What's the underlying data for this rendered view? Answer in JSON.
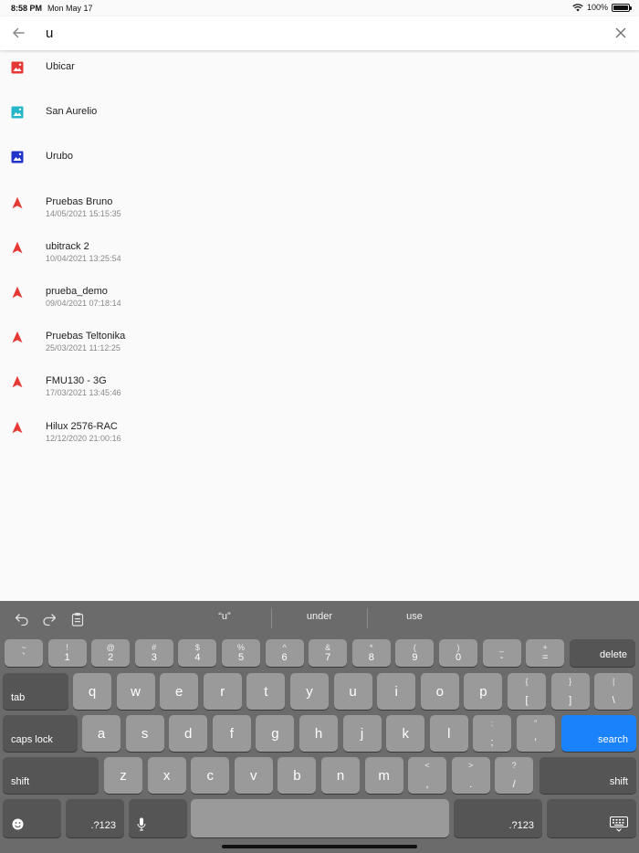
{
  "status": {
    "time": "8:58 PM",
    "date": "Mon May 17",
    "battery": "100%"
  },
  "search": {
    "query": "u",
    "placeholder": ""
  },
  "results": [
    {
      "type": "map",
      "color": "#e53935",
      "title": "Ubicar",
      "subtitle": ""
    },
    {
      "type": "map",
      "color": "#26b6c9",
      "title": "San Aurelio",
      "subtitle": ""
    },
    {
      "type": "map",
      "color": "#2233c9",
      "title": "Urubo",
      "subtitle": ""
    },
    {
      "type": "vehicle",
      "color": "#e53935",
      "title": "Pruebas Bruno",
      "subtitle": "14/05/2021 15:15:35"
    },
    {
      "type": "vehicle",
      "color": "#e53935",
      "title": "ubitrack 2",
      "subtitle": "10/04/2021 13:25:54"
    },
    {
      "type": "vehicle",
      "color": "#e53935",
      "title": "prueba_demo",
      "subtitle": "09/04/2021 07:18:14"
    },
    {
      "type": "vehicle",
      "color": "#e53935",
      "title": "Pruebas Teltonika",
      "subtitle": "25/03/2021 11:12:25"
    },
    {
      "type": "vehicle",
      "color": "#e53935",
      "title": "FMU130 - 3G",
      "subtitle": "17/03/2021 13:45:46"
    },
    {
      "type": "vehicle",
      "color": "#e53935",
      "title": "Hilux 2576-RAC",
      "subtitle": "12/12/2020 21:00:16"
    }
  ],
  "keyboard": {
    "predictions": [
      "“u”",
      "under",
      "use"
    ],
    "number_row": [
      {
        "top": "~",
        "bot": "`"
      },
      {
        "top": "!",
        "bot": "1"
      },
      {
        "top": "@",
        "bot": "2"
      },
      {
        "top": "#",
        "bot": "3"
      },
      {
        "top": "$",
        "bot": "4"
      },
      {
        "top": "%",
        "bot": "5"
      },
      {
        "top": "^",
        "bot": "6"
      },
      {
        "top": "&",
        "bot": "7"
      },
      {
        "top": "*",
        "bot": "8"
      },
      {
        "top": "(",
        "bot": "9"
      },
      {
        "top": ")",
        "bot": "0"
      },
      {
        "top": "_",
        "bot": "-"
      },
      {
        "top": "+",
        "bot": "="
      }
    ],
    "delete": "delete",
    "tab": "tab",
    "row_q": [
      "q",
      "w",
      "e",
      "r",
      "t",
      "y",
      "u",
      "i",
      "o",
      "p"
    ],
    "row_q_symbols": [
      {
        "top": "{",
        "bot": "["
      },
      {
        "top": "}",
        "bot": "]"
      },
      {
        "top": "|",
        "bot": "\\"
      }
    ],
    "caps_lock": "caps lock",
    "row_a": [
      "a",
      "s",
      "d",
      "f",
      "g",
      "h",
      "j",
      "k",
      "l"
    ],
    "row_a_symbols": [
      {
        "top": ":",
        "bot": ";"
      },
      {
        "top": "”",
        "bot": "’"
      }
    ],
    "search": "search",
    "shift": "shift",
    "row_z": [
      "z",
      "x",
      "c",
      "v",
      "b",
      "n",
      "m"
    ],
    "row_z_symbols": [
      {
        "top": "<",
        "bot": ","
      },
      {
        "top": ">",
        "bot": "."
      },
      {
        "top": "?",
        "bot": "/"
      }
    ],
    "num_switch": ".?123"
  }
}
